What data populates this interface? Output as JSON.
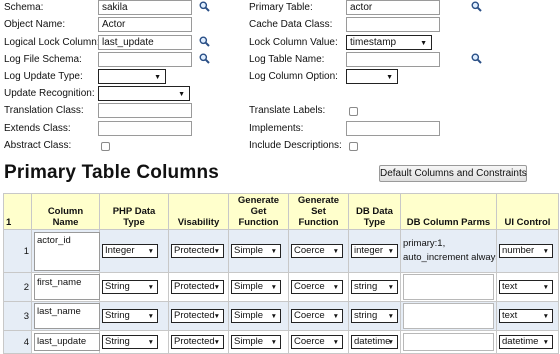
{
  "form": {
    "schema": {
      "label": "Schema:",
      "value": "sakila"
    },
    "object_name": {
      "label": "Object Name:",
      "value": "Actor"
    },
    "logical_lock_column": {
      "label": "Logical Lock Column:",
      "value": "last_update"
    },
    "log_file_schema": {
      "label": "Log File Schema:",
      "value": ""
    },
    "log_update_type": {
      "label": "Log Update Type:",
      "value": ""
    },
    "update_recognition": {
      "label": "Update Recognition:",
      "value": ""
    },
    "translation_class": {
      "label": "Translation Class:",
      "value": ""
    },
    "extends_class": {
      "label": "Extends Class:",
      "value": ""
    },
    "abstract_class": {
      "label": "Abstract Class:"
    },
    "primary_table": {
      "label": "Primary Table:",
      "value": "actor"
    },
    "cache_data_class": {
      "label": "Cache Data Class:",
      "value": ""
    },
    "lock_column_value": {
      "label": "Lock Column Value:",
      "value": "timestamp"
    },
    "log_table_name": {
      "label": "Log Table Name:",
      "value": ""
    },
    "log_column_option": {
      "label": "Log Column Option:",
      "value": ""
    },
    "translate_labels": {
      "label": "Translate Labels:"
    },
    "implements": {
      "label": "Implements:",
      "value": ""
    },
    "include_descriptions": {
      "label": "Include Descriptions:"
    }
  },
  "section_title": "Primary Table Columns",
  "default_button": "Default Columns and Constraints",
  "table": {
    "corner": "1",
    "headers": {
      "column_name": "Column Name",
      "php_data_type": "PHP Data Type",
      "visability": "Visability",
      "generate_get": "Generate Get Function",
      "generate_set": "Generate Set Function",
      "db_data_type": "DB Data Type",
      "db_column_parms": "DB Column Parms",
      "ui_control": "UI Control"
    },
    "rows": [
      {
        "num": "1",
        "column_name": "actor_id",
        "php_type": "Integer",
        "visability": "Protected",
        "get": "Simple",
        "set": "Coerce",
        "db_type": "integer",
        "parms_line1": "primary:1,",
        "parms_line2": "auto_increment always",
        "ui": "number"
      },
      {
        "num": "2",
        "column_name": "first_name",
        "php_type": "String",
        "visability": "Protected",
        "get": "Simple",
        "set": "Coerce",
        "db_type": "string",
        "parms_line1": "",
        "parms_line2": "",
        "ui": "text"
      },
      {
        "num": "3",
        "column_name": "last_name",
        "php_type": "String",
        "visability": "Protected",
        "get": "Simple",
        "set": "Coerce",
        "db_type": "string",
        "parms_line1": "",
        "parms_line2": "",
        "ui": "text"
      },
      {
        "num": "4",
        "column_name": "last_update",
        "php_type": "String",
        "visability": "Protected",
        "get": "Simple",
        "set": "Coerce",
        "db_type": "datetime",
        "parms_line1": "",
        "parms_line2": "",
        "ui": "datetime"
      }
    ]
  },
  "icons": {
    "lookup": "magnifier-icon",
    "dropdown": "dropdown-arrow-icon"
  }
}
